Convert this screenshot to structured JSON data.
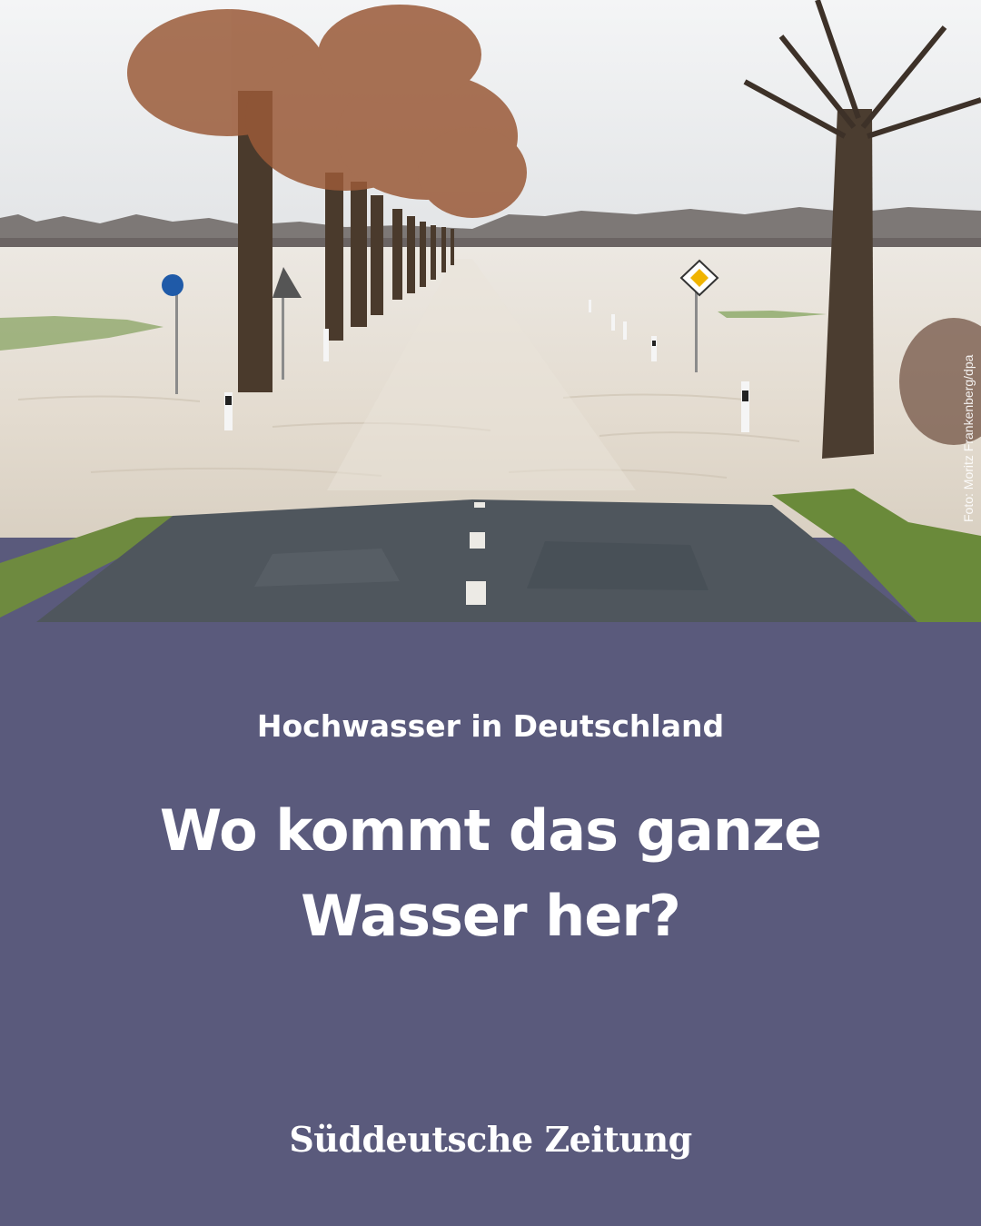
{
  "photo": {
    "credit": "Foto: Moritz Frankenberg/dpa",
    "sky_color": "#eceeef",
    "water_color": "#e6e0d6",
    "road_color": "#4d545b",
    "grass_color": "#6d8a3c"
  },
  "panel": {
    "kicker": "Hochwasser in Deutschland",
    "headline": "Wo kommt das ganze Wasser her?",
    "logo": "Süddeutsche Zeitung",
    "background": "#5a5a7c"
  }
}
